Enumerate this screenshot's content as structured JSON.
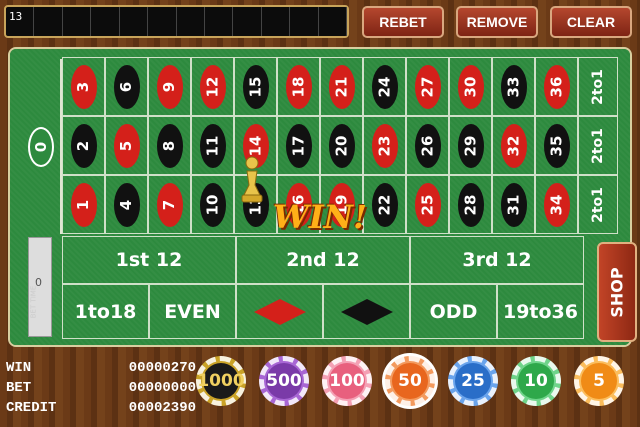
{
  "history": {
    "last_number": "13"
  },
  "toolbar": {
    "rebet": "REBET",
    "remove": "REMOVE",
    "clear": "CLEAR"
  },
  "board": {
    "zero": "0",
    "rows": [
      [
        {
          "n": "3",
          "c": "red"
        },
        {
          "n": "6",
          "c": "black"
        },
        {
          "n": "9",
          "c": "red"
        },
        {
          "n": "12",
          "c": "red"
        },
        {
          "n": "15",
          "c": "black"
        },
        {
          "n": "18",
          "c": "red"
        },
        {
          "n": "21",
          "c": "red"
        },
        {
          "n": "24",
          "c": "black"
        },
        {
          "n": "27",
          "c": "red"
        },
        {
          "n": "30",
          "c": "red"
        },
        {
          "n": "33",
          "c": "black"
        },
        {
          "n": "36",
          "c": "red"
        }
      ],
      [
        {
          "n": "2",
          "c": "black"
        },
        {
          "n": "5",
          "c": "red"
        },
        {
          "n": "8",
          "c": "black"
        },
        {
          "n": "11",
          "c": "black"
        },
        {
          "n": "14",
          "c": "red"
        },
        {
          "n": "17",
          "c": "black"
        },
        {
          "n": "20",
          "c": "black"
        },
        {
          "n": "23",
          "c": "red"
        },
        {
          "n": "26",
          "c": "black"
        },
        {
          "n": "29",
          "c": "black"
        },
        {
          "n": "32",
          "c": "red"
        },
        {
          "n": "35",
          "c": "black"
        }
      ],
      [
        {
          "n": "1",
          "c": "red"
        },
        {
          "n": "4",
          "c": "black"
        },
        {
          "n": "7",
          "c": "red"
        },
        {
          "n": "10",
          "c": "black"
        },
        {
          "n": "13",
          "c": "black"
        },
        {
          "n": "16",
          "c": "red"
        },
        {
          "n": "19",
          "c": "red"
        },
        {
          "n": "22",
          "c": "black"
        },
        {
          "n": "25",
          "c": "red"
        },
        {
          "n": "28",
          "c": "black"
        },
        {
          "n": "31",
          "c": "black"
        },
        {
          "n": "34",
          "c": "red"
        }
      ]
    ],
    "column_bets": [
      "2to1",
      "2to1",
      "2to1"
    ],
    "dozens": [
      "1st 12",
      "2nd 12",
      "3rd 12"
    ],
    "outside": {
      "low": "1to18",
      "even": "EVEN",
      "odd": "ODD",
      "high": "19to36"
    },
    "bet_time_label": "BET TIME",
    "bet_time_value": "0",
    "win_banner": "WIN!"
  },
  "shop": "SHOP",
  "stats": [
    {
      "label": "WIN",
      "value": "00000270"
    },
    {
      "label": "BET",
      "value": "00000000"
    },
    {
      "label": "CREDIT",
      "value": "00002390"
    }
  ],
  "chips": [
    {
      "value": "1000",
      "color": "#1a1a1a",
      "ring": "#c9a227"
    },
    {
      "value": "500",
      "color": "#7a3aa8",
      "ring": "#a866d4"
    },
    {
      "value": "100",
      "color": "#e8607e",
      "ring": "#f4a0b4"
    },
    {
      "value": "50",
      "color": "#e8661e",
      "ring": "#f39a5e",
      "selected": true
    },
    {
      "value": "25",
      "color": "#2a6ec8",
      "ring": "#6aa4ec"
    },
    {
      "value": "10",
      "color": "#2ea84a",
      "ring": "#6fd48a"
    },
    {
      "value": "5",
      "color": "#f08b16",
      "ring": "#fbbd5c"
    }
  ]
}
